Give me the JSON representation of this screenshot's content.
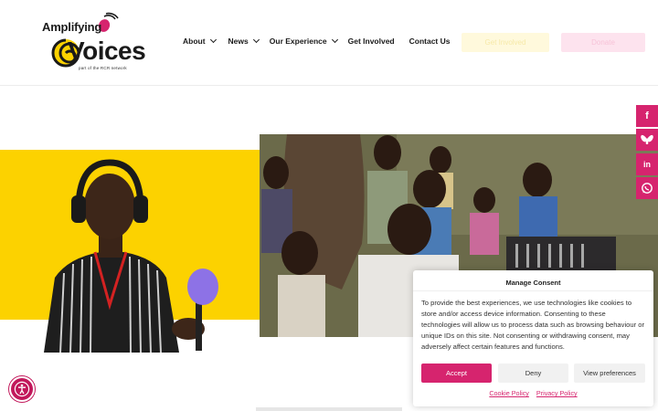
{
  "brand": {
    "name_top": "Amplifying",
    "name_main": "Voices",
    "tagline": "part of the RCR network",
    "colors": {
      "magenta": "#d6246e",
      "yellow": "#fcd200",
      "dark": "#1a1a1a"
    }
  },
  "nav": {
    "items": [
      {
        "label": "About",
        "dropdown": true
      },
      {
        "label": "News",
        "dropdown": true
      },
      {
        "label": "Our Experience",
        "dropdown": true
      },
      {
        "label": "Get Involved",
        "dropdown": false
      },
      {
        "label": "Contact Us",
        "dropdown": false
      }
    ],
    "cta_primary": "Get Involved",
    "cta_secondary": "Donate"
  },
  "social": [
    {
      "icon": "facebook-icon",
      "glyph": "f"
    },
    {
      "icon": "bluesky-icon",
      "glyph": ""
    },
    {
      "icon": "linkedin-icon",
      "glyph": "in"
    },
    {
      "icon": "whatsapp-icon",
      "glyph": ""
    }
  ],
  "consent": {
    "title": "Manage Consent",
    "body": "To provide the best experiences, we use technologies like cookies to store and/or access device information. Consenting to these technologies will allow us to process data such as browsing behaviour or unique IDs on this site. Not consenting or withdrawing consent, may adversely affect certain features and functions.",
    "accept": "Accept",
    "deny": "Deny",
    "preferences": "View preferences",
    "cookie_policy": "Cookie Policy",
    "privacy_policy": "Privacy Policy"
  },
  "accessibility": {
    "icon": "accessibility-icon"
  }
}
